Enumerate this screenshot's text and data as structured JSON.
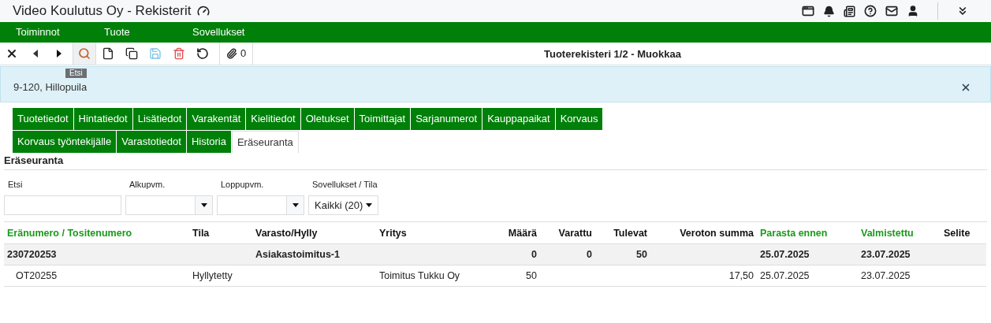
{
  "window": {
    "title": "Video Koulutus Oy - Rekisterit"
  },
  "menu": [
    "Toiminnot",
    "Tuote",
    "Sovellukset"
  ],
  "toolbar": {
    "buttons": [
      {
        "kind": "close",
        "selected": false
      },
      {
        "kind": "prev",
        "selected": false
      },
      {
        "kind": "next",
        "selected": false
      },
      {
        "kind": "search",
        "selected": true
      },
      {
        "kind": "new",
        "selected": false
      },
      {
        "kind": "copy",
        "selected": false
      },
      {
        "kind": "save",
        "selected": false
      },
      {
        "kind": "delete",
        "selected": false
      },
      {
        "kind": "undo",
        "selected": false
      }
    ],
    "attachments": "0",
    "title": "Tuoterekisteri 1/2 - Muokkaa",
    "tooltip": "Etsi"
  },
  "alert": {
    "text": "9-120, Hillopuila"
  },
  "tab_rows": [
    [
      {
        "label": "Tuotetiedot",
        "selected": false
      },
      {
        "label": "Hintatiedot",
        "selected": false
      },
      {
        "label": "Lisätiedot",
        "selected": false
      },
      {
        "label": "Varakentät",
        "selected": false
      },
      {
        "label": "Kielitiedot",
        "selected": false
      },
      {
        "label": "Oletukset",
        "selected": false
      },
      {
        "label": "Toimittajat",
        "selected": false
      },
      {
        "label": "Sarjanumerot",
        "selected": false
      },
      {
        "label": "Kauppapaikat",
        "selected": false
      },
      {
        "label": "Korvaus",
        "selected": false
      }
    ],
    [
      {
        "label": "Korvaus työntekijälle",
        "selected": false
      },
      {
        "label": "Varastotiedot",
        "selected": false
      },
      {
        "label": "Historia",
        "selected": false
      },
      {
        "label": "Eräseuranta",
        "selected": true
      }
    ]
  ],
  "section_title": "Eräseuranta",
  "filters": [
    {
      "label": "Etsi",
      "kind": "text"
    },
    {
      "label": "Alkupvm.",
      "kind": "date"
    },
    {
      "label": "Loppupvm.",
      "kind": "date"
    },
    {
      "label": "Sovellukset / Tila",
      "kind": "select",
      "value": "Kaikki (20)"
    }
  ],
  "table": {
    "columns": [
      {
        "label": "Eränumero / Tositenumero",
        "sorted": true
      },
      {
        "label": "Tila",
        "sorted": false
      },
      {
        "label": "Varasto/Hylly",
        "sorted": false
      },
      {
        "label": "Yritys",
        "sorted": false
      },
      {
        "label": "Määrä",
        "sorted": false
      },
      {
        "label": "Varattu",
        "sorted": false
      },
      {
        "label": "Tulevat",
        "sorted": false
      },
      {
        "label": "Veroton summa",
        "sorted": false
      },
      {
        "label": "Parasta ennen",
        "sorted": true
      },
      {
        "label": "Valmistettu",
        "sorted": true
      },
      {
        "label": "Selite",
        "sorted": false
      }
    ],
    "rows": [
      {
        "kind": "group",
        "cells": [
          "230720253",
          "",
          "Asiakastoimitus-1",
          "",
          "0",
          "0",
          "50",
          "",
          "25.07.2025",
          "23.07.2025",
          ""
        ]
      },
      {
        "kind": "item",
        "cells": [
          "OT20255",
          "Hyllytetty",
          "",
          "Toimitus Tukku Oy",
          "50",
          "",
          "",
          "17,50",
          "25.07.2025",
          "23.07.2025",
          ""
        ]
      }
    ]
  }
}
